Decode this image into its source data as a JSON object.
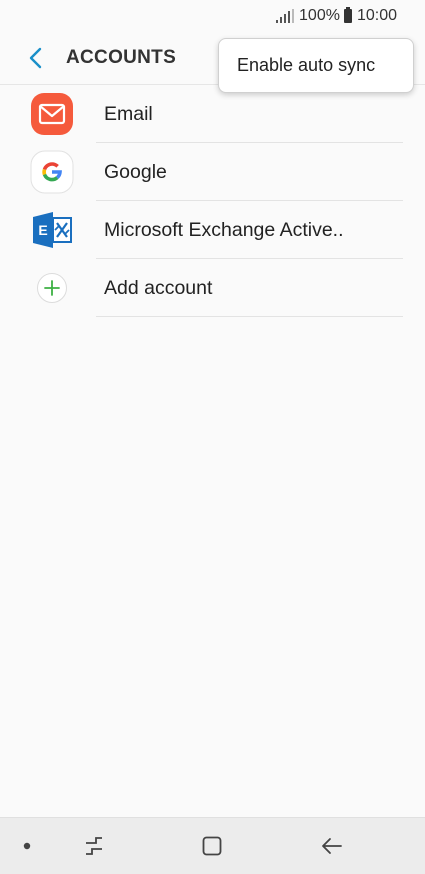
{
  "status_bar": {
    "battery_percent": "100%",
    "time": "10:00"
  },
  "header": {
    "title": "ACCOUNTS",
    "back_icon": "chevron-left-icon"
  },
  "popup_menu": {
    "items": [
      {
        "label": "Enable auto sync"
      }
    ]
  },
  "accounts": [
    {
      "label": "Email",
      "icon": "email-icon"
    },
    {
      "label": "Google",
      "icon": "google-icon"
    },
    {
      "label": "Microsoft Exchange Active..",
      "icon": "exchange-icon"
    },
    {
      "label": "Add account",
      "icon": "add-icon"
    }
  ],
  "nav_bar": {
    "items": [
      "dot-icon",
      "recent-apps-icon",
      "home-icon",
      "back-arrow-icon"
    ]
  },
  "colors": {
    "accent": "#1a8fc9",
    "email": "#f55a3c",
    "exchange": "#1a6fbf",
    "add": "#3cb043"
  }
}
